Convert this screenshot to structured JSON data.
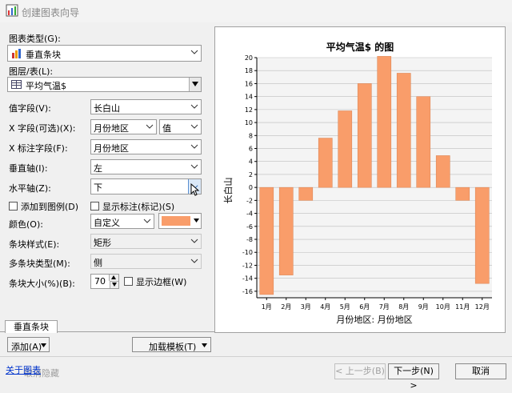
{
  "window": {
    "title": "创建图表向导"
  },
  "left": {
    "chart_type_label": "图表类型(G):",
    "chart_type_value": "垂直条块",
    "layer_label": "图层/表(L):",
    "layer_value": "平均气温$",
    "value_field_label": "值字段(V):",
    "value_field_value": "长白山",
    "x_field_label": "X 字段(可选)(X):",
    "x_field_value": "月份地区",
    "x_field_value2": "值",
    "x_tag_label": "X 标注字段(F):",
    "x_tag_value": "月份地区",
    "vaxis_label": "垂直轴(I):",
    "vaxis_value": "左",
    "haxis_label": "水平轴(Z):",
    "haxis_value": "下",
    "add_legend_label": "添加到图例(D)",
    "show_labels_label": "显示标注(标记)(S)",
    "color_label": "颜色(O):",
    "color_value": "自定义",
    "bar_style_label": "条块样式(E):",
    "bar_style_value": "矩形",
    "multi_bar_label": "多条块类型(M):",
    "multi_bar_value": "侧",
    "bar_size_label": "条块大小(%)(B):",
    "bar_size_value": "70",
    "show_border_label": "显示边框(W)",
    "tab_label": "垂直条块",
    "add_button": "添加(A)",
    "load_template_button": "加载模板(T)"
  },
  "footer": {
    "about_link": "关于图表",
    "hidden_text": "取消隐藏",
    "prev_button": "< 上一步(B)",
    "next_button": "下一步(N) >",
    "cancel_button": "取消"
  },
  "colors": {
    "bar": "#f99d6a",
    "bar_stroke": "#d9804f",
    "accent": "#0033cc"
  },
  "icons": {
    "app": "chart-wizard-icon",
    "chart_type": "bar-chart-icon",
    "layer": "table-icon"
  },
  "chart_data": {
    "type": "bar",
    "title": "平均气温$ 的图",
    "xlabel": "月份地区: 月份地区",
    "ylabel": "长白山",
    "categories": [
      "1月",
      "2月",
      "3月",
      "4月",
      "5月",
      "6月",
      "7月",
      "8月",
      "9月",
      "10月",
      "11月",
      "12月"
    ],
    "values": [
      -16.5,
      -13.5,
      -2,
      7.6,
      11.8,
      16,
      20.2,
      17.6,
      14,
      4.9,
      -2,
      -14.8
    ],
    "ylim": [
      -17,
      20
    ],
    "yticks": [
      -16,
      -14,
      -12,
      -10,
      -8,
      -6,
      -4,
      -2,
      0,
      2,
      4,
      6,
      8,
      10,
      12,
      14,
      16,
      18,
      20
    ],
    "grid": true
  }
}
